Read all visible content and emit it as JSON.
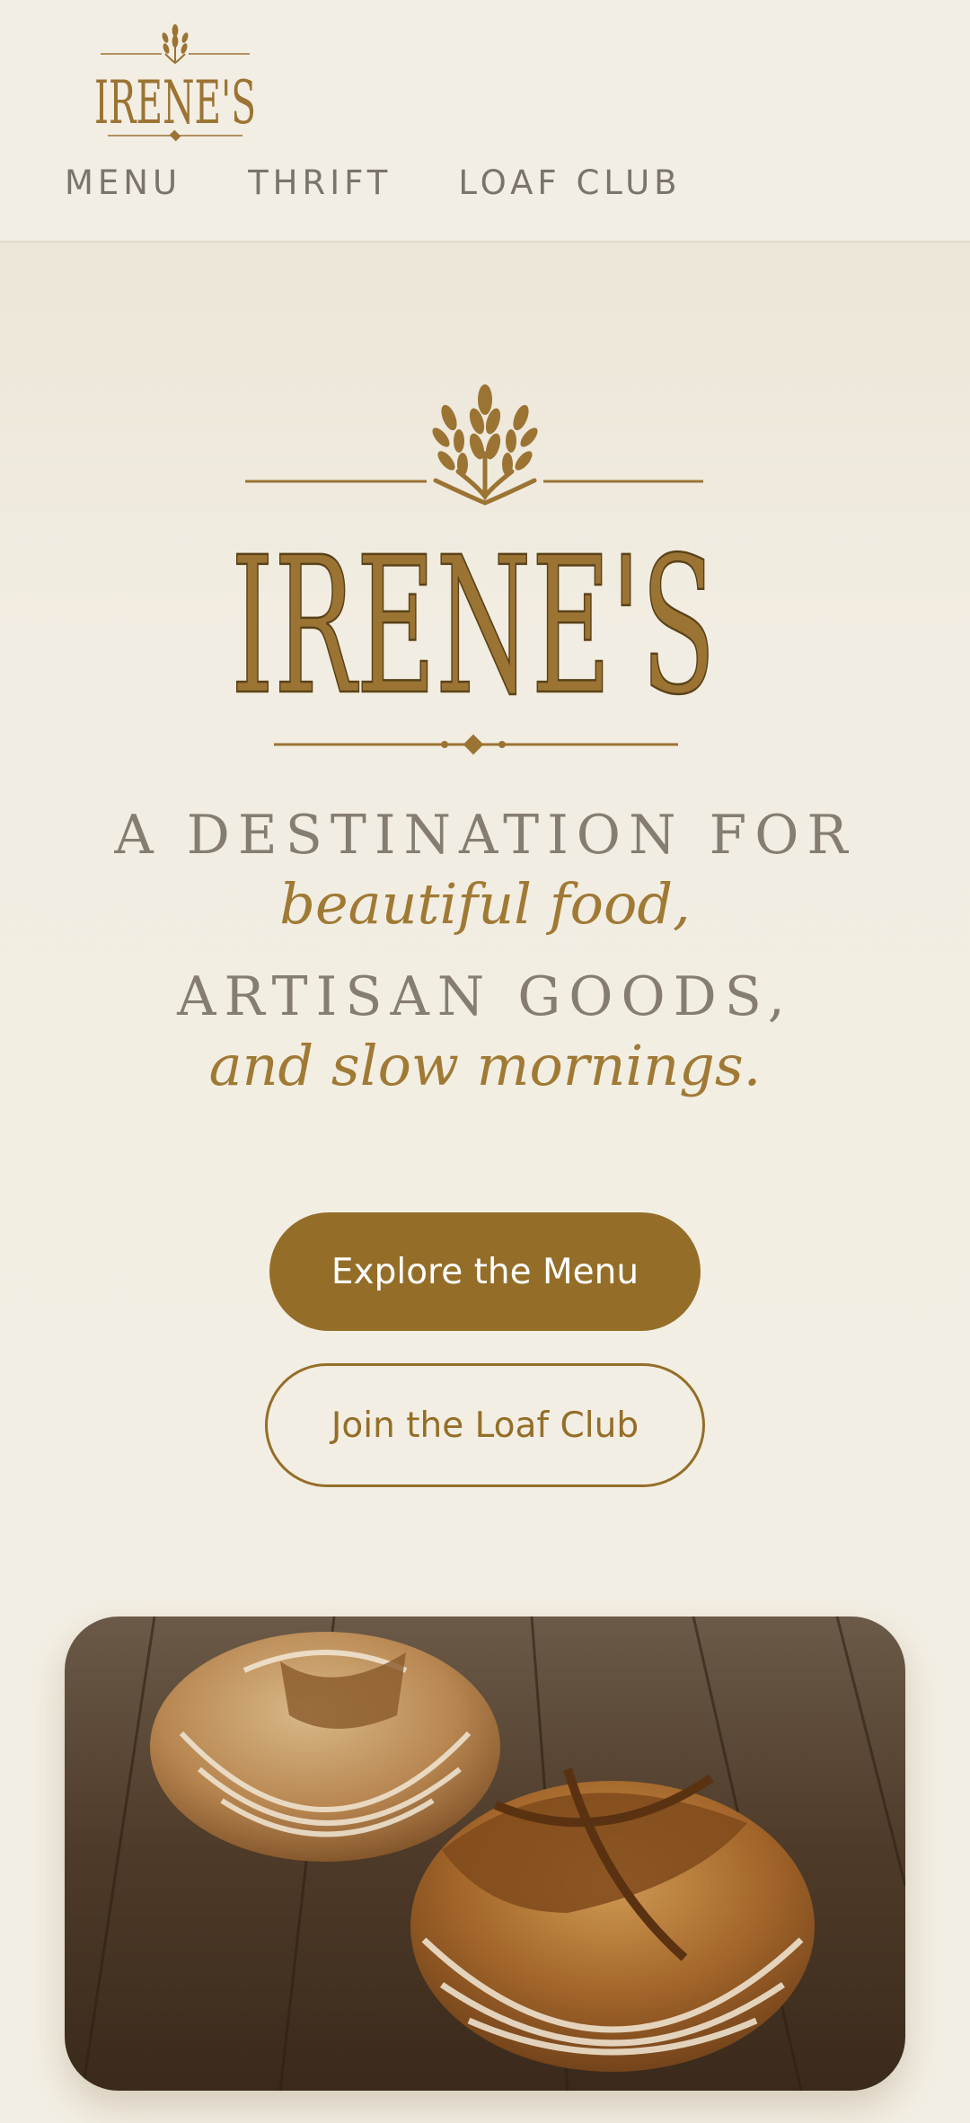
{
  "brand": {
    "name": "IRENE'S",
    "accent": "#946e28",
    "logo_color": "#9b7434"
  },
  "nav": {
    "items": [
      {
        "label": "MENU"
      },
      {
        "label": "THRIFT"
      },
      {
        "label": "LOAF CLUB"
      }
    ]
  },
  "hero": {
    "line1": "A DESTINATION FOR",
    "line2": "beautiful food,",
    "line3": "ARTISAN GOODS,",
    "line4": "and slow mornings."
  },
  "buttons": {
    "primary": "Explore the Menu",
    "secondary": "Join the Loaf Club"
  },
  "image": {
    "subject": "two sourdough loaves on a wooden table"
  }
}
